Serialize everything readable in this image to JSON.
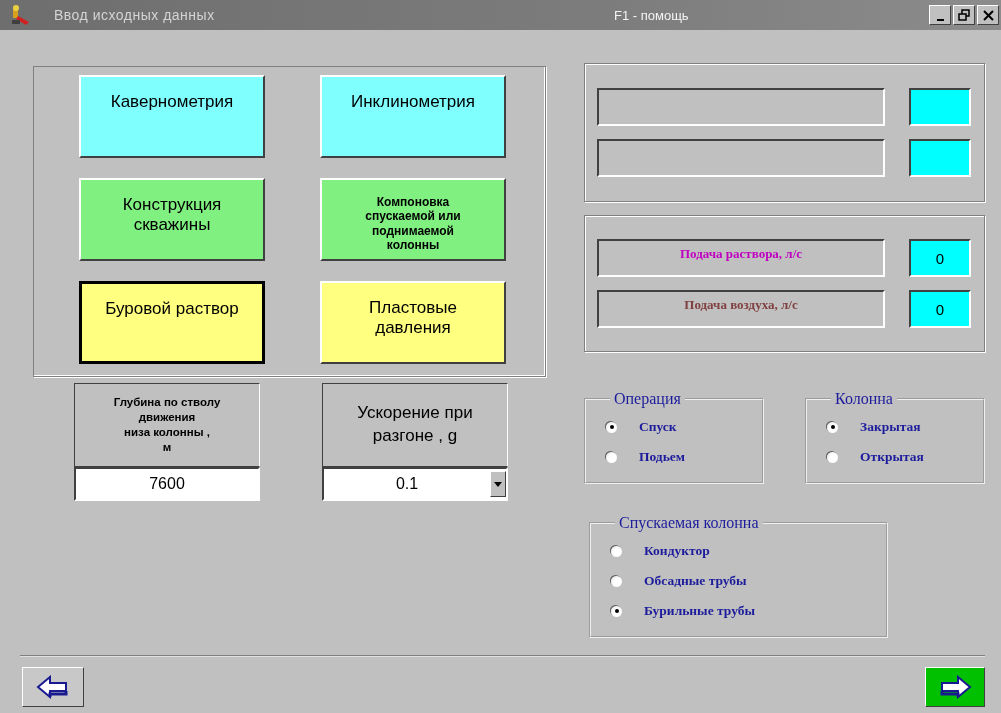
{
  "window": {
    "title": "Ввод исходных данных",
    "hint": "F1 - помощь"
  },
  "sections": [
    {
      "label": "Кавернометрия",
      "color": "#80ffff",
      "selected": false,
      "kind": "large"
    },
    {
      "label": "Инклинометрия",
      "color": "#80ffff",
      "selected": false,
      "kind": "large"
    },
    {
      "label": "Конструкция скважины",
      "color": "#80f080",
      "selected": false,
      "kind": "large"
    },
    {
      "label": "Компоновка спускаемой или поднимаемой колонны",
      "color": "#80f080",
      "selected": false,
      "kind": "small"
    },
    {
      "label": "Буровой раствор",
      "color": "#ffff80",
      "selected": true,
      "kind": "large"
    },
    {
      "label": "Пластовые давления",
      "color": "#ffff80",
      "selected": false,
      "kind": "large"
    }
  ],
  "parameters": [
    {
      "kind": "input",
      "label": "Глубина по стволу\nдвижения\nниза колонны ,\nм",
      "value": "7600"
    },
    {
      "kind": "dropdown",
      "label": "Ускорение при\nразгоне , g",
      "value": "0.1"
    }
  ],
  "readout_panels": [
    {
      "rows": [
        {
          "kind": "empty"
        },
        {
          "kind": "empty"
        }
      ]
    },
    {
      "rows": [
        {
          "kind": "value",
          "label": "Подача раствора, л/с",
          "color": "#c000c0",
          "value": "0"
        },
        {
          "kind": "value",
          "label": "Подача воздуха, л/с",
          "color": "#804040",
          "value": "0"
        }
      ]
    }
  ],
  "radio_groups": [
    {
      "title": "Операция",
      "options": [
        {
          "label": "Спуск",
          "selected": true
        },
        {
          "label": "Подьем",
          "selected": false
        }
      ]
    },
    {
      "title": "Колонна",
      "options": [
        {
          "label": "Закрытая",
          "selected": true
        },
        {
          "label": "Открытая",
          "selected": false
        }
      ]
    },
    {
      "title": "Спускаемая колонна",
      "options": [
        {
          "label": "Кондуктор",
          "selected": false
        },
        {
          "label": "Обсадные трубы",
          "selected": false
        },
        {
          "label": "Бурильные трубы",
          "selected": true
        }
      ]
    }
  ]
}
